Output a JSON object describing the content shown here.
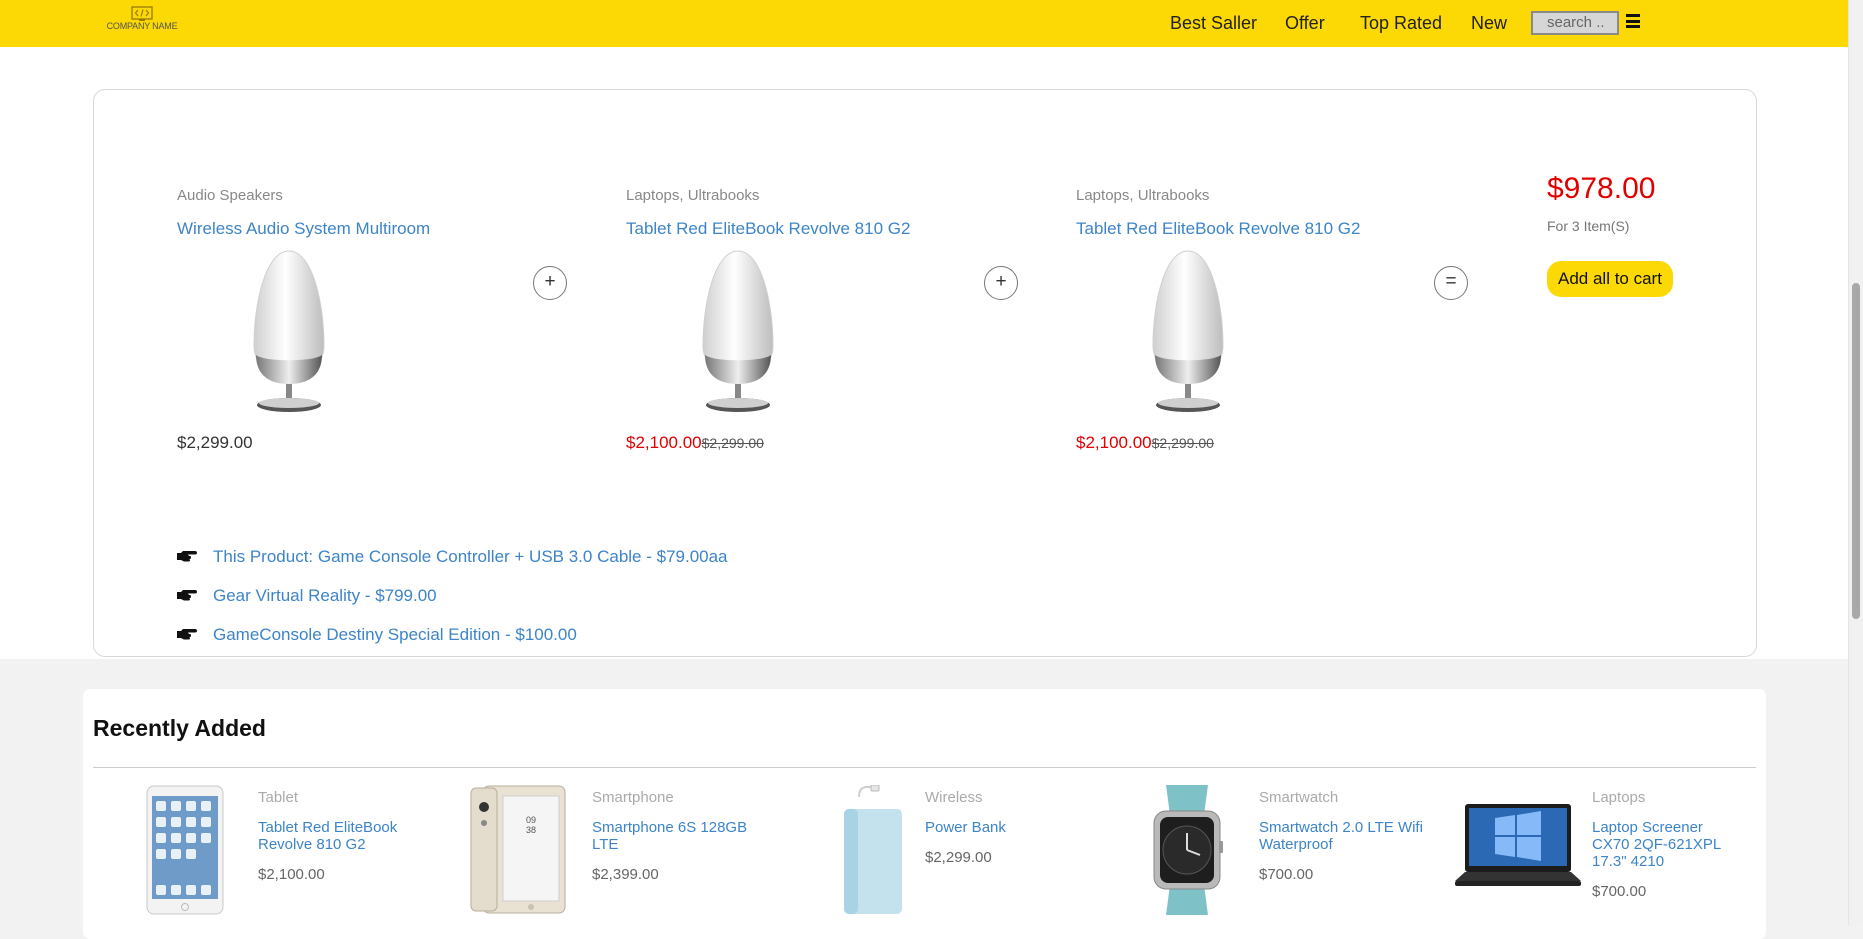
{
  "header": {
    "logo_text": "COMPANY NAME",
    "nav": [
      {
        "label": "Best Saller"
      },
      {
        "label": "Offer"
      },
      {
        "label": "Top Rated"
      },
      {
        "label": "New"
      }
    ],
    "search_placeholder": "search .."
  },
  "bundle": {
    "products": [
      {
        "category": "Audio Speakers",
        "title": "Wireless Audio System Multiroom",
        "price": "$2,299.00",
        "old_price": ""
      },
      {
        "category": "Laptops, Ultrabooks",
        "title": "Tablet Red EliteBook Revolve 810 G2",
        "price": "$2,100.00",
        "old_price": "$2,299.00"
      },
      {
        "category": "Laptops, Ultrabooks",
        "title": "Tablet Red EliteBook Revolve 810 G2",
        "price": "$2,100.00",
        "old_price": "$2,299.00"
      }
    ],
    "plus": "+",
    "equals": "=",
    "total_price": "$978.00",
    "total_items": "For 3 Item(S)",
    "add_all_label": "Add all to cart",
    "related": [
      "This Product: Game Console Controller + USB 3.0 Cable - $79.00aa",
      "Gear Virtual Reality - $799.00",
      "GameConsole Destiny Special Edition - $100.00"
    ]
  },
  "recently_added": {
    "heading": "Recently Added",
    "items": [
      {
        "category": "Tablet",
        "title": "Tablet Red EliteBook Revolve 810 G2",
        "price": "$2,100.00",
        "icon": "tablet"
      },
      {
        "category": "Smartphone",
        "title": "Smartphone 6S 128GB LTE",
        "price": "$2,399.00",
        "icon": "smartphone"
      },
      {
        "category": "Wireless",
        "title": "Power Bank",
        "price": "$2,299.00",
        "icon": "power-bank"
      },
      {
        "category": "Smartwatch",
        "title": "Smartwatch 2.0 LTE Wifi Waterproof",
        "price": "$700.00",
        "icon": "smartwatch"
      },
      {
        "category": "Laptops",
        "title": "Laptop Screener CX70 2QF-621XPL 17.3\" 4210",
        "price": "$700.00",
        "icon": "laptop"
      }
    ]
  },
  "colors": {
    "header_bg": "#fcd804",
    "link": "#3d84c9",
    "sale": "#e00000"
  }
}
